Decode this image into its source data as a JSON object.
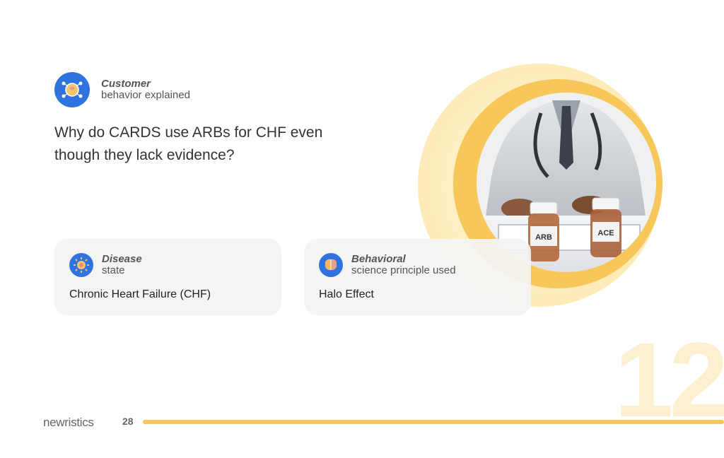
{
  "header": {
    "title_bold": "Customer",
    "title_sub": "behavior explained",
    "icon": "brain-network-icon"
  },
  "question": "Why do CARDS use ARBs for CHF even though they lack evidence?",
  "cards": [
    {
      "label_bold": "Disease",
      "label_sub": "state",
      "value": "Chronic Heart Failure (CHF)",
      "icon": "sun-virus-icon"
    },
    {
      "label_bold": "Behavioral",
      "label_sub": "science principle used",
      "value": "Halo Effect",
      "icon": "brain-icon"
    }
  ],
  "image": {
    "bottle_left_label": "ARB",
    "bottle_right_label": "ACE"
  },
  "footer": {
    "logo": "newristics",
    "page_number": "28",
    "section_number": "12"
  },
  "colors": {
    "accent_blue": "#2f73e0",
    "accent_yellow": "#f7c75a",
    "pale_yellow": "#fdf0cf"
  }
}
